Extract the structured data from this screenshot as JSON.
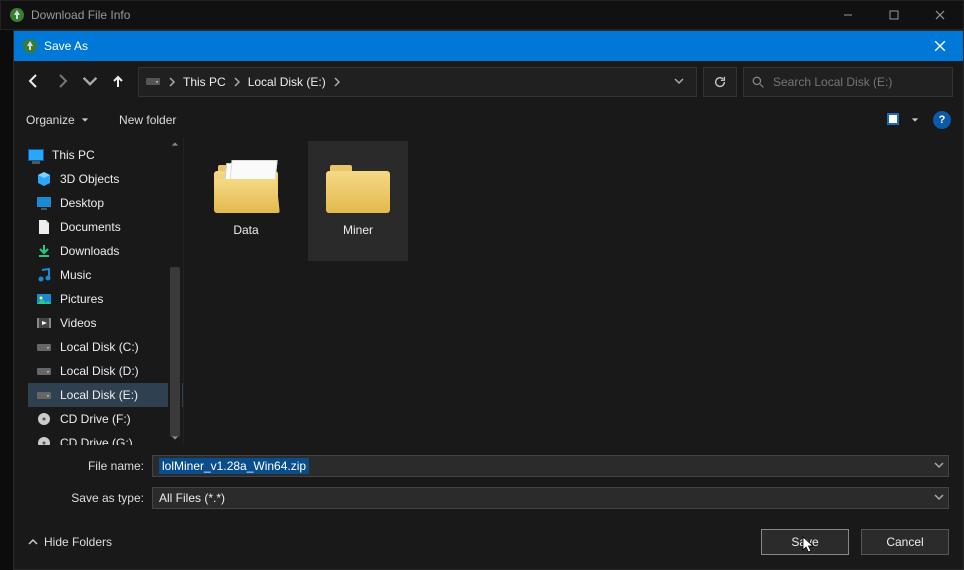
{
  "parent_window": {
    "title": "Download File Info"
  },
  "dialog": {
    "title": "Save As"
  },
  "breadcrumb": {
    "root": "This PC",
    "drive": "Local Disk (E:)"
  },
  "search": {
    "placeholder": "Search Local Disk (E:)"
  },
  "toolbar": {
    "organize": "Organize",
    "new_folder": "New folder"
  },
  "tree": {
    "header": "This PC",
    "items": [
      "3D Objects",
      "Desktop",
      "Documents",
      "Downloads",
      "Music",
      "Pictures",
      "Videos",
      "Local Disk (C:)",
      "Local Disk (D:)",
      "Local Disk (E:)",
      "CD Drive (F:)",
      "CD Drive (G:)"
    ],
    "selected_index": 9
  },
  "folders": [
    {
      "name": "Data"
    },
    {
      "name": "Miner"
    }
  ],
  "filename": {
    "label": "File name:",
    "value": "lolMiner_v1.28a_Win64.zip"
  },
  "savetype": {
    "label": "Save as type:",
    "value": "All Files (*.*)"
  },
  "footer": {
    "hide": "Hide Folders",
    "save": "Save",
    "cancel": "Cancel"
  }
}
